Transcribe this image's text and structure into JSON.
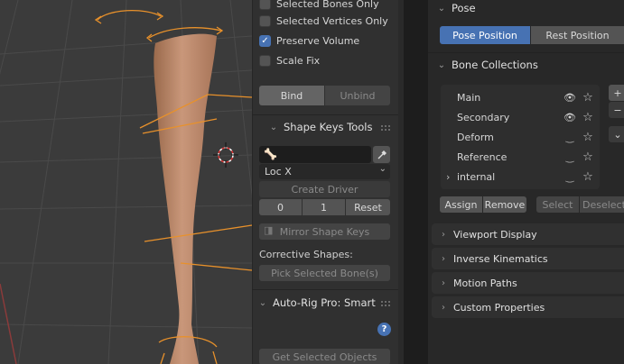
{
  "viewport": {},
  "arp_panel": {
    "checkboxes": [
      {
        "label": "Selected Bones Only",
        "checked": false
      },
      {
        "label": "Selected Vertices Only",
        "checked": false
      },
      {
        "label": "Preserve Volume",
        "checked": true
      },
      {
        "label": "Scale Fix",
        "checked": false
      }
    ],
    "bind_label": "Bind",
    "unbind_label": "Unbind",
    "shape_keys_title": "Shape Keys Tools",
    "bone_field_value": "",
    "loc_select": "Loc X",
    "create_driver": "Create Driver",
    "value_min": "0",
    "value_max": "1",
    "reset": "Reset",
    "mirror_shape_keys": "Mirror Shape Keys",
    "corrective_shapes": "Corrective Shapes:",
    "pick_selected_bones": "Pick Selected Bone(s)",
    "auto_rig_title": "Auto-Rig Pro: Smart",
    "help_icon": "question-icon",
    "get_selected_objects": "Get Selected Objects"
  },
  "properties": {
    "pose_title": "Pose",
    "pose_position": "Pose Position",
    "rest_position": "Rest Position",
    "bone_collections_title": "Bone Collections",
    "collections": [
      {
        "name": "Main",
        "visible": true,
        "expandable": false
      },
      {
        "name": "Secondary",
        "visible": true,
        "expandable": false
      },
      {
        "name": "Deform",
        "visible": false,
        "expandable": false
      },
      {
        "name": "Reference",
        "visible": false,
        "expandable": false
      },
      {
        "name": "internal",
        "visible": false,
        "expandable": true
      }
    ],
    "assign": "Assign",
    "remove": "Remove",
    "select": "Select",
    "deselect": "Deselect",
    "sections": [
      "Viewport Display",
      "Inverse Kinematics",
      "Motion Paths",
      "Custom Properties"
    ]
  }
}
